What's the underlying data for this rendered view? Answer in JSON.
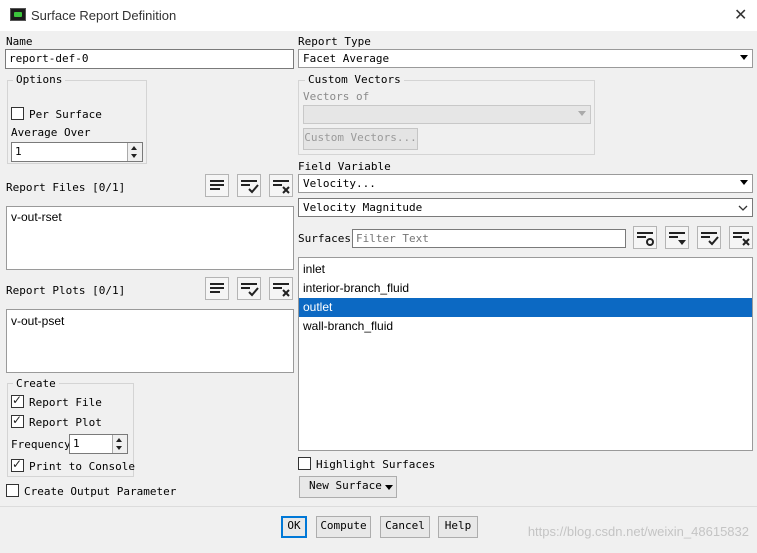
{
  "window": {
    "title": "Surface Report Definition",
    "icon": "fluent-app-icon",
    "close_icon": "close-icon"
  },
  "name": {
    "label": "Name",
    "value": "report-def-0"
  },
  "options": {
    "title": "Options",
    "per_surface": {
      "label": "Per Surface",
      "checked": false
    },
    "average_over": {
      "label": "Average Over",
      "value": "1"
    }
  },
  "report_files": {
    "label": "Report Files [0/1]",
    "items": [
      "v-out-rset"
    ]
  },
  "report_plots": {
    "label": "Report Plots [0/1]",
    "items": [
      "v-out-pset"
    ]
  },
  "create": {
    "title": "Create",
    "report_file": {
      "label": "Report File",
      "checked": true
    },
    "report_plot": {
      "label": "Report Plot",
      "checked": true
    },
    "frequency": {
      "label": "Frequency",
      "value": "1"
    },
    "print_to_console": {
      "label": "Print to Console",
      "checked": true
    }
  },
  "create_output_parameter": {
    "label": "Create Output Parameter",
    "checked": false
  },
  "report_type": {
    "label": "Report Type",
    "value": "Facet Average"
  },
  "custom_vectors": {
    "title": "Custom Vectors",
    "vectors_of_label": "Vectors of",
    "vectors_of_value": "",
    "button": "Custom Vectors..."
  },
  "field_variable": {
    "label": "Field Variable",
    "category": "Velocity...",
    "quantity": "Velocity Magnitude"
  },
  "surfaces": {
    "label": "Surfaces",
    "filter_placeholder": "Filter Text",
    "items": [
      {
        "label": "inlet",
        "selected": false
      },
      {
        "label": "interior-branch_fluid",
        "selected": false
      },
      {
        "label": "outlet",
        "selected": true
      },
      {
        "label": "wall-branch_fluid",
        "selected": false
      }
    ]
  },
  "highlight_surfaces": {
    "label": "Highlight Surfaces",
    "checked": false
  },
  "new_surface": {
    "label": "New Surface"
  },
  "buttons": {
    "ok": "OK",
    "compute": "Compute",
    "cancel": "Cancel",
    "help": "Help"
  },
  "watermark": "https://blog.csdn.net/weixin_48615832",
  "colors": {
    "selection": "#0c69c3",
    "default_button_border": "#0078d7"
  }
}
